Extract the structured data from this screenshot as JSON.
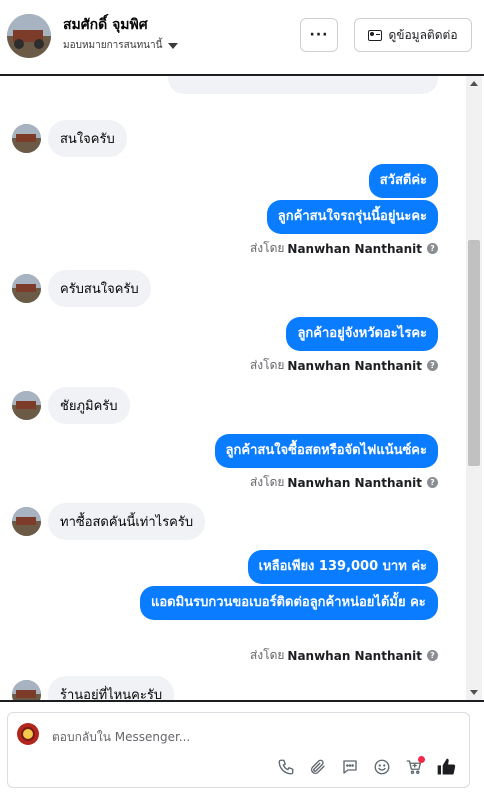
{
  "header": {
    "contact_name": "สมศักดิ์ จุมพิศ",
    "assign_label": "มอบหมายการสนทนานี้",
    "more_label": "···",
    "view_contact_label": "ดูข้อมูลติดต่อ"
  },
  "messages": [
    {
      "direction": "in",
      "text": "สนใจครับ"
    },
    {
      "direction": "out",
      "text": "สวัสดีค่ะ"
    },
    {
      "direction": "out",
      "text": "ลูกค้าสนใจรถรุ่นนี้อยู่นะคะ"
    },
    {
      "direction": "sent_by",
      "prefix": "ส่งโดย",
      "name": "Nanwhan Nanthanit"
    },
    {
      "direction": "in",
      "text": "ครับสนใจครับ"
    },
    {
      "direction": "out",
      "text": "ลูกค้าอยู่จังหวัดอะไรคะ"
    },
    {
      "direction": "sent_by",
      "prefix": "ส่งโดย",
      "name": "Nanwhan Nanthanit"
    },
    {
      "direction": "in",
      "text": "ชัยภูมิครับ"
    },
    {
      "direction": "out",
      "text": "ลูกค้าสนใจซื้อสดหรือจัดไฟแน้นซ์คะ"
    },
    {
      "direction": "sent_by",
      "prefix": "ส่งโดย",
      "name": "Nanwhan Nanthanit"
    },
    {
      "direction": "in",
      "text": "ทาซื้อสดคันนี้เท่าไรครับ"
    },
    {
      "direction": "out",
      "text": "เหลือเพียง 139,000 บาท ค่ะ"
    },
    {
      "direction": "out",
      "text": "แอดมินรบกวนขอเบอร์ติดต่อลูกค้าหน่อยได้มั้ย คะ"
    },
    {
      "direction": "sent_by",
      "prefix": "ส่งโดย",
      "name": "Nanwhan Nanthanit"
    },
    {
      "direction": "in",
      "text": "ร้านอยู่ที่ไหนคะรับ"
    }
  ],
  "composer": {
    "placeholder": "ตอบกลับใน Messenger...",
    "tools": [
      "phone-icon",
      "attach-icon",
      "chat-bubble-icon",
      "emoji-icon",
      "cart-icon",
      "like-icon"
    ]
  },
  "colors": {
    "outgoing_bubble": "#0a7cff",
    "incoming_bubble": "#f0f2f5",
    "notification_dot": "#f02849"
  }
}
